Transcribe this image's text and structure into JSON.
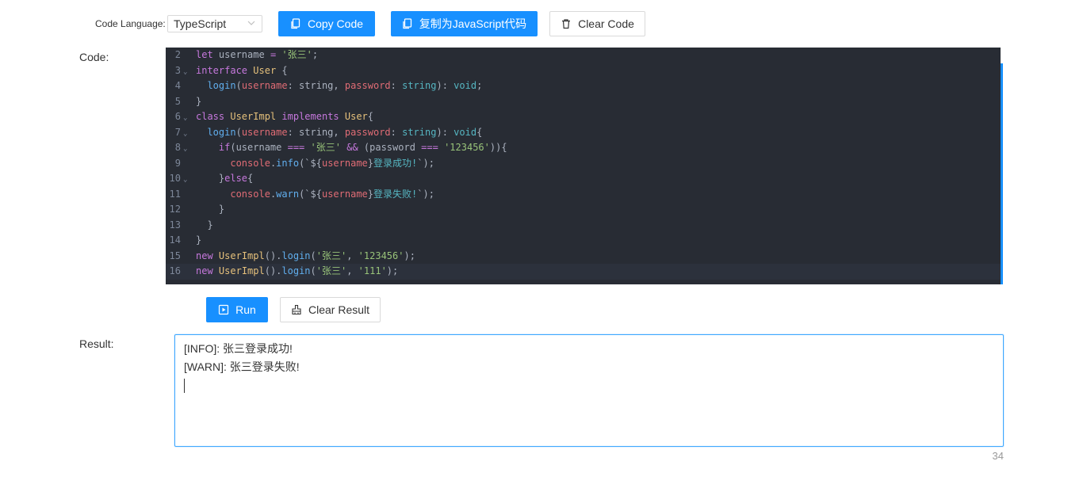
{
  "toolbar": {
    "language_label": "Code Language:",
    "language_value": "TypeScript",
    "copy_code": "Copy Code",
    "copy_as_js": "复制为JavaScript代码",
    "clear_code": "Clear Code"
  },
  "editor": {
    "label": "Code:",
    "lines": [
      {
        "n": "2",
        "fold": false
      },
      {
        "n": "3",
        "fold": true
      },
      {
        "n": "4",
        "fold": false
      },
      {
        "n": "5",
        "fold": false
      },
      {
        "n": "6",
        "fold": true
      },
      {
        "n": "7",
        "fold": true
      },
      {
        "n": "8",
        "fold": true
      },
      {
        "n": "9",
        "fold": false
      },
      {
        "n": "10",
        "fold": true
      },
      {
        "n": "11",
        "fold": false
      },
      {
        "n": "12",
        "fold": false
      },
      {
        "n": "13",
        "fold": false
      },
      {
        "n": "14",
        "fold": false
      },
      {
        "n": "15",
        "fold": false
      },
      {
        "n": "16",
        "fold": false
      }
    ],
    "code": [
      [
        [
          "kw",
          "let"
        ],
        [
          "pl",
          " username "
        ],
        [
          "kw",
          "="
        ],
        [
          "pl",
          " "
        ],
        [
          "str",
          "'张三'"
        ],
        [
          "pl",
          ";"
        ]
      ],
      [
        [
          "kw",
          "interface"
        ],
        [
          "pl",
          " "
        ],
        [
          "ty",
          "User"
        ],
        [
          "pl",
          " {"
        ]
      ],
      [
        [
          "pl",
          "  "
        ],
        [
          "fn",
          "login"
        ],
        [
          "pl",
          "("
        ],
        [
          "prm",
          "username"
        ],
        [
          "pl",
          ": string, "
        ],
        [
          "prm",
          "password"
        ],
        [
          "pl",
          ": "
        ],
        [
          "tp",
          "string"
        ],
        [
          "pl",
          "): "
        ],
        [
          "tp",
          "void"
        ],
        [
          "pl",
          ";"
        ]
      ],
      [
        [
          "pl",
          "}"
        ]
      ],
      [
        [
          "kw",
          "class"
        ],
        [
          "pl",
          " "
        ],
        [
          "ty",
          "UserImpl"
        ],
        [
          "pl",
          " "
        ],
        [
          "kw",
          "implements"
        ],
        [
          "pl",
          " "
        ],
        [
          "ty",
          "User"
        ],
        [
          "pl",
          "{"
        ]
      ],
      [
        [
          "pl",
          "  "
        ],
        [
          "fn",
          "login"
        ],
        [
          "pl",
          "("
        ],
        [
          "prm",
          "username"
        ],
        [
          "pl",
          ": string, "
        ],
        [
          "prm",
          "password"
        ],
        [
          "pl",
          ": "
        ],
        [
          "tp",
          "string"
        ],
        [
          "pl",
          "): "
        ],
        [
          "tp",
          "void"
        ],
        [
          "pl",
          "{"
        ]
      ],
      [
        [
          "pl",
          "    "
        ],
        [
          "kw",
          "if"
        ],
        [
          "pl",
          "(username "
        ],
        [
          "kw",
          "==="
        ],
        [
          "pl",
          " "
        ],
        [
          "str",
          "'张三'"
        ],
        [
          "pl",
          " "
        ],
        [
          "kw",
          "&&"
        ],
        [
          "pl",
          " (password "
        ],
        [
          "kw",
          "==="
        ],
        [
          "pl",
          " "
        ],
        [
          "str",
          "'123456'"
        ],
        [
          "pl",
          ")){"
        ]
      ],
      [
        [
          "pl",
          "      "
        ],
        [
          "prm",
          "console"
        ],
        [
          "pl",
          "."
        ],
        [
          "fn",
          "info"
        ],
        [
          "pl",
          "(`${"
        ],
        [
          "prm",
          "username"
        ],
        [
          "pl",
          "}"
        ],
        [
          "tp",
          "登录成功!"
        ],
        [
          "pl",
          "`);"
        ]
      ],
      [
        [
          "pl",
          "    }"
        ],
        [
          "kw",
          "else"
        ],
        [
          "pl",
          "{"
        ]
      ],
      [
        [
          "pl",
          "      "
        ],
        [
          "prm",
          "console"
        ],
        [
          "pl",
          "."
        ],
        [
          "fn",
          "warn"
        ],
        [
          "pl",
          "(`${"
        ],
        [
          "prm",
          "username"
        ],
        [
          "pl",
          "}"
        ],
        [
          "tp",
          "登录失败!"
        ],
        [
          "pl",
          "`);"
        ]
      ],
      [
        [
          "pl",
          "    }"
        ]
      ],
      [
        [
          "pl",
          "  }"
        ]
      ],
      [
        [
          "pl",
          "}"
        ]
      ],
      [
        [
          "kw",
          "new"
        ],
        [
          "pl",
          " "
        ],
        [
          "ty",
          "UserImpl"
        ],
        [
          "pl",
          "()."
        ],
        [
          "fn",
          "login"
        ],
        [
          "pl",
          "("
        ],
        [
          "str",
          "'张三'"
        ],
        [
          "pl",
          ", "
        ],
        [
          "str",
          "'123456'"
        ],
        [
          "pl",
          ");"
        ]
      ],
      [
        [
          "kw",
          "new"
        ],
        [
          "pl",
          " "
        ],
        [
          "ty",
          "UserImpl"
        ],
        [
          "pl",
          "()."
        ],
        [
          "fn",
          "login"
        ],
        [
          "pl",
          "("
        ],
        [
          "str",
          "'张三'"
        ],
        [
          "pl",
          ", "
        ],
        [
          "str",
          "'111'"
        ],
        [
          "pl",
          ");"
        ]
      ]
    ]
  },
  "actions": {
    "run": "Run",
    "clear_result": "Clear Result"
  },
  "result": {
    "label": "Result:",
    "lines": [
      "[INFO]:  张三登录成功!",
      "[WARN]:  张三登录失败!"
    ],
    "char_count": "34"
  },
  "colors": {
    "primary": "#1890ff",
    "editor_bg": "#282c34",
    "keyword": "#c678dd",
    "string": "#98c379",
    "type": "#e5c07b",
    "function": "#61afef",
    "parameter": "#e06c75",
    "builtin": "#56b6c2"
  }
}
